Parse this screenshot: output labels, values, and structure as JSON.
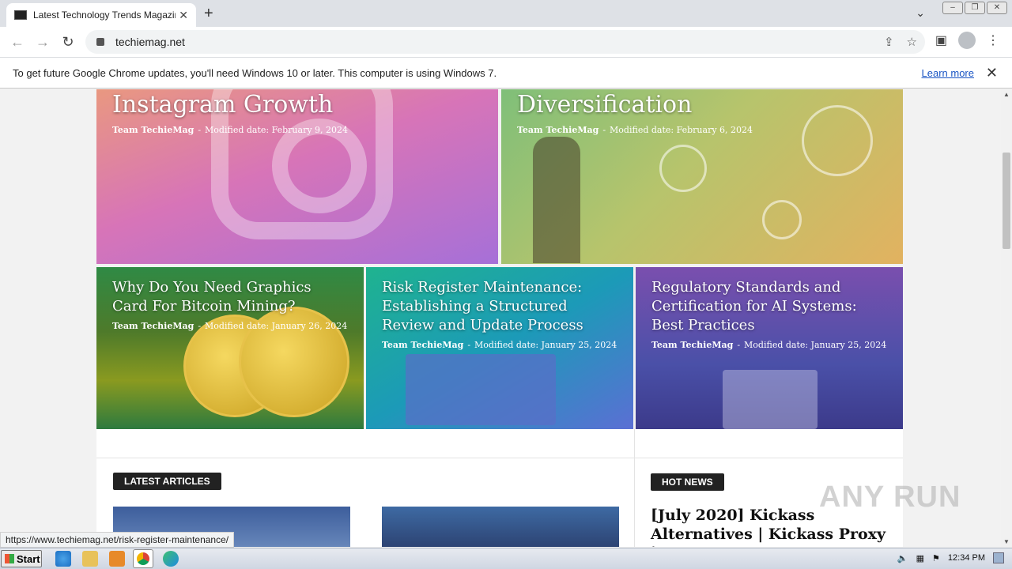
{
  "browser": {
    "tab_title": "Latest Technology Trends Magazine -",
    "url": "techiemag.net",
    "status_url": "https://www.techiemag.net/risk-register-maintenance/"
  },
  "infobar": {
    "message": "To get future Google Chrome updates, you'll need Windows 10 or later. This computer is using Windows 7.",
    "learn_more": "Learn more"
  },
  "featured": [
    {
      "title": "Instagram Growth",
      "author": "Team TechieMag",
      "date": "Modified date: February 9, 2024"
    },
    {
      "title": "Diversification",
      "author": "Team TechieMag",
      "date": "Modified date: February 6, 2024"
    },
    {
      "title": "Why Do You Need Graphics Card For Bitcoin Mining?",
      "author": "Team TechieMag",
      "date": "Modified date: January 26, 2024"
    },
    {
      "title": "Risk Register Maintenance: Establishing a Structured Review and Update Process",
      "author": "Team TechieMag",
      "date": "Modified date: January 25, 2024"
    },
    {
      "title": "Regulatory Standards and Certification for AI Systems: Best Practices",
      "author": "Team TechieMag",
      "date": "Modified date: January 25, 2024"
    }
  ],
  "sections": {
    "latest": "LATEST ARTICLES",
    "hot": "HOT NEWS",
    "hot_title": "[July 2020] Kickass Alternatives | Kickass Proxy |"
  },
  "watermark": "ANY RUN",
  "taskbar": {
    "start": "Start",
    "time": "12:34 PM"
  },
  "colors": {
    "accent_link": "#1a55c4",
    "badge_bg": "#222222"
  }
}
